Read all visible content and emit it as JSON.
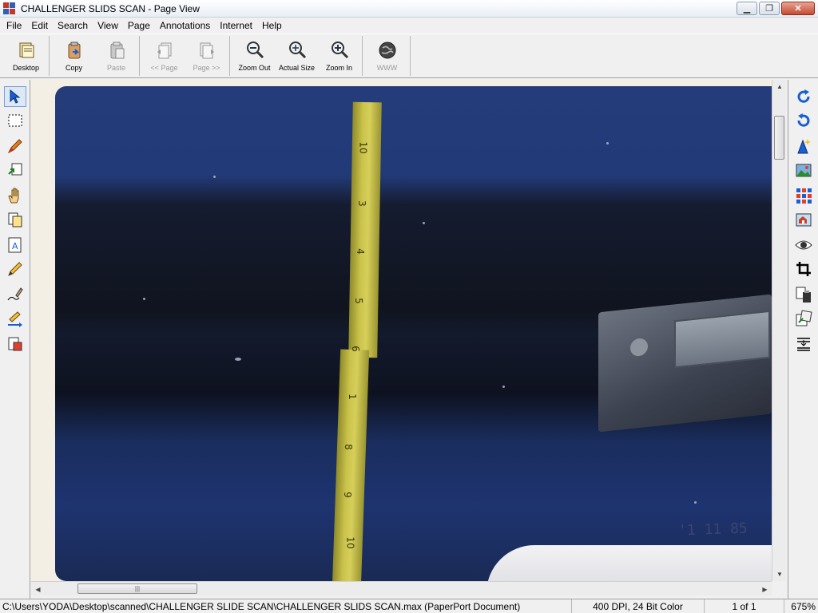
{
  "window": {
    "title": "CHALLENGER SLIDS SCAN - Page View"
  },
  "menu": [
    "File",
    "Edit",
    "Search",
    "View",
    "Page",
    "Annotations",
    "Internet",
    "Help"
  ],
  "toolbar": {
    "desktop": "Desktop",
    "copy": "Copy",
    "paste": "Paste",
    "prev_page": "<< Page",
    "next_page": "Page >>",
    "zoom_out": "Zoom Out",
    "actual_size": "Actual Size",
    "zoom_in": "Zoom In",
    "www": "WWW"
  },
  "slide": {
    "ruler_ticks": [
      "10",
      "3",
      "4",
      "5",
      "6",
      "1",
      "8",
      "9",
      "10"
    ],
    "stamp": "'1 11 85"
  },
  "status": {
    "path": "C:\\Users\\YODA\\Desktop\\scanned\\CHALLENGER SLIDE SCAN\\CHALLENGER SLIDS SCAN.max (PaperPort Document)",
    "resolution": "400 DPI, 24 Bit Color",
    "page": "1 of 1",
    "zoom": "675%"
  },
  "colors": {
    "accent": "#1a5fd0",
    "slide_blue": "#223a77",
    "ruler": "#d6cf5a"
  }
}
